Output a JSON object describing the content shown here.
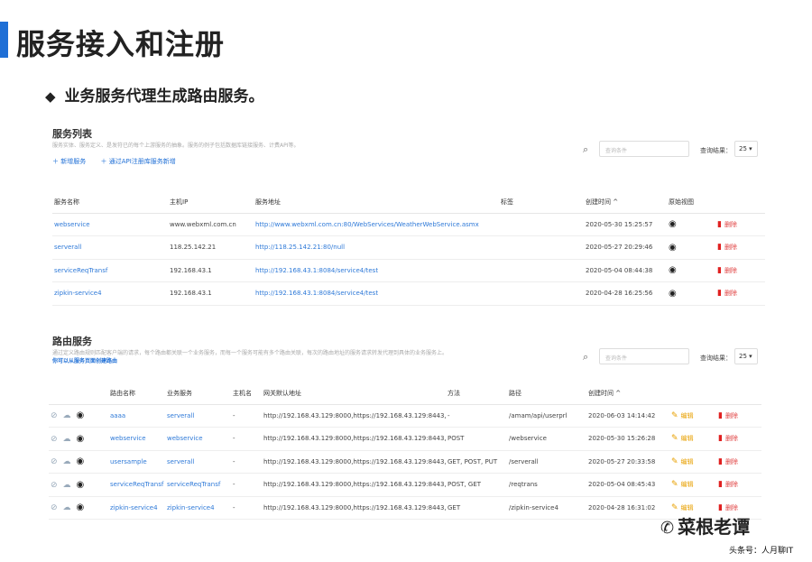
{
  "slide": {
    "title": "服务接入和注册",
    "bullet": "业务服务代理生成路由服务。"
  },
  "services": {
    "title": "服务列表",
    "desc": "服务实体、服务定义、是发符已的每个上游服务的抽象。服务的例子包括数据库链接服务、计费API等。",
    "links": [
      "＋ 新增服务",
      "＋ 通过API注册库服务新增"
    ],
    "search_placeholder": "查询条件",
    "query_label": "查询结果：",
    "page_size": "25",
    "columns": [
      "服务名称",
      "主机IP",
      "服务地址",
      "标签",
      "创建时间 ^",
      "原始视图"
    ],
    "rows": [
      {
        "name": "webservice",
        "ip": "www.webxml.com.cn",
        "addr": "http://www.webxml.com.cn:80/WebServices/WeatherWebService.asmx",
        "tag": "",
        "time": "2020-05-30 15:25:57",
        "del": "删除"
      },
      {
        "name": "serverall",
        "ip": "118.25.142.21",
        "addr": "http://118.25.142.21:80/null",
        "tag": "",
        "time": "2020-05-27 20:29:46",
        "del": "删除"
      },
      {
        "name": "serviceReqTransf",
        "ip": "192.168.43.1",
        "addr": "http://192.168.43.1:8084/service4/test",
        "tag": "",
        "time": "2020-05-04 08:44:38",
        "del": "删除"
      },
      {
        "name": "zipkin-service4",
        "ip": "192.168.43.1",
        "addr": "http://192.168.43.1:8084/service4/test",
        "tag": "",
        "time": "2020-04-28 16:25:56",
        "del": "删除"
      }
    ]
  },
  "routes": {
    "title": "路由服务",
    "desc": "通过定义路由规则匹配客户端的请求，每个路由都关联一个业务服务，而每一个服务可能有多个路由关联，每次的路由地址的服务请求转发代理到具体的业务服务上。",
    "link": "你可以从服务页面创建路由",
    "search_placeholder": "查询条件",
    "query_label": "查询结果：",
    "page_size": "25",
    "columns": [
      "路由名称",
      "业务服务",
      "主机名",
      "网关默认地址",
      "方法",
      "路径",
      "创建时间 ^"
    ],
    "rows": [
      {
        "name": "aaaa",
        "service": "serverall",
        "host": "-",
        "gw": "http://192.168.43.129:8000,https://192.168.43.129:8443,",
        "method": "-",
        "path": "/amam/api/userprl",
        "time": "2020-06-03 14:14:42",
        "edit": "编辑",
        "del": "删除"
      },
      {
        "name": "webservice",
        "service": "webservice",
        "host": "-",
        "gw": "http://192.168.43.129:8000,https://192.168.43.129:8443,",
        "method": "POST",
        "path": "/webservice",
        "time": "2020-05-30 15:26:28",
        "edit": "编辑",
        "del": "删除"
      },
      {
        "name": "usersample",
        "service": "serverall",
        "host": "-",
        "gw": "http://192.168.43.129:8000,https://192.168.43.129:8443,",
        "method": "GET, POST, PUT",
        "path": "/serverall",
        "time": "2020-05-27 20:33:58",
        "edit": "编辑",
        "del": "删除"
      },
      {
        "name": "serviceReqTransf",
        "service": "serviceReqTransf",
        "host": "-",
        "gw": "http://192.168.43.129:8000,https://192.168.43.129:8443,",
        "method": "POST, GET",
        "path": "/reqtrans",
        "time": "2020-05-04 08:45:43",
        "edit": "编辑",
        "del": "删除"
      },
      {
        "name": "zipkin-service4",
        "service": "zipkin-service4",
        "host": "-",
        "gw": "http://192.168.43.129:8000,https://192.168.43.129:8443,",
        "method": "GET",
        "path": "/zipkin-service4",
        "time": "2020-04-28 16:31:02",
        "edit": "编辑",
        "del": "删除"
      }
    ]
  },
  "watermark": {
    "name": "菜根老谭",
    "footer": "头条号：人月聊IT"
  },
  "colors": {
    "accent": "#1f6fd6",
    "danger": "#e02020",
    "warn": "#e8a000"
  }
}
